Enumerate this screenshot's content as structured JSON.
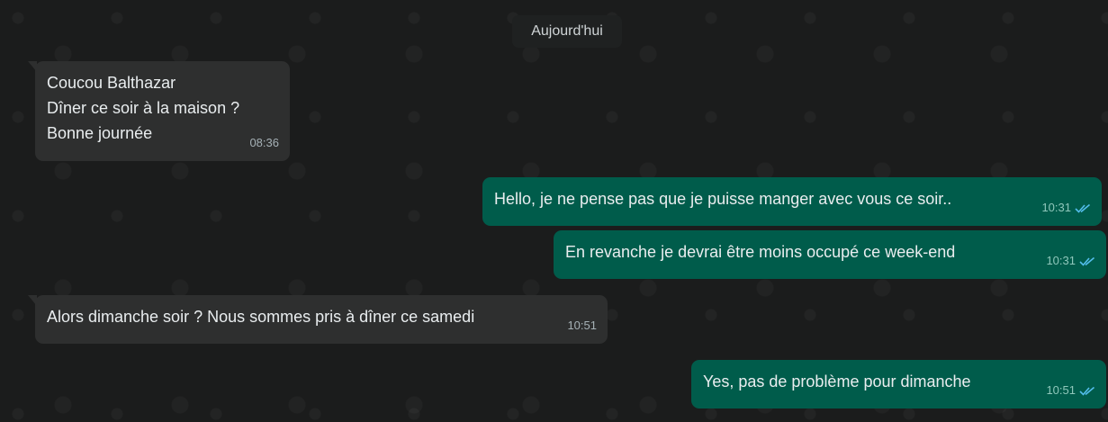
{
  "date_chip": "Aujourd'hui",
  "messages": [
    {
      "direction": "incoming",
      "lines": [
        "Coucou Balthazar",
        "Dîner ce soir à la maison ?",
        "Bonne journée"
      ],
      "time": "08:36"
    },
    {
      "direction": "outgoing",
      "lines": [
        "Hello, je ne pense pas que je puisse manger avec vous ce soir.."
      ],
      "time": "10:31",
      "status": "read"
    },
    {
      "direction": "outgoing",
      "lines": [
        "En revanche je devrai être moins occupé ce week-end"
      ],
      "time": "10:31",
      "status": "read"
    },
    {
      "direction": "incoming",
      "lines": [
        "Alors dimanche soir ? Nous sommes pris à dîner ce samedi"
      ],
      "time": "10:51"
    },
    {
      "direction": "outgoing",
      "lines": [
        "Yes, pas de problème pour dimanche"
      ],
      "time": "10:51",
      "status": "read"
    }
  ],
  "colors": {
    "incoming_bubble": "#2e2f2f",
    "outgoing_bubble": "#005c4b",
    "read_ticks": "#53bdeb"
  },
  "icons": {
    "read_status": "double-check-icon"
  }
}
